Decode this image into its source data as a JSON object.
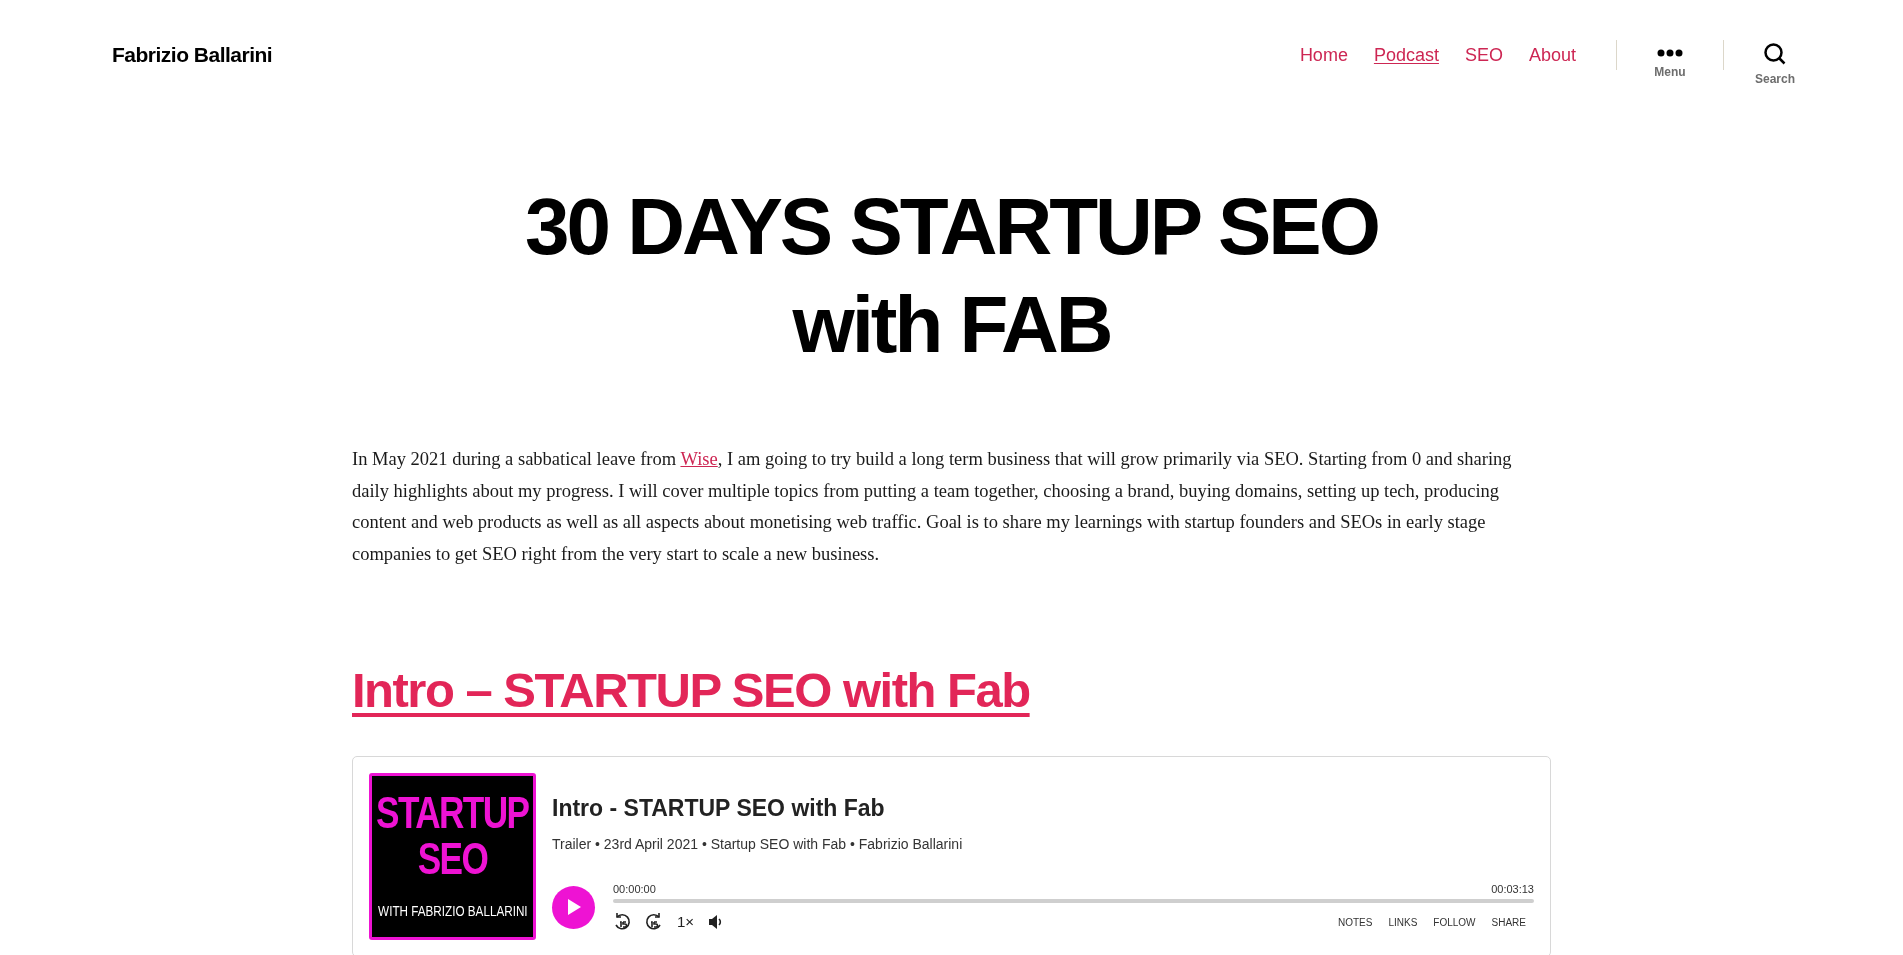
{
  "site_title": "Fabrizio Ballarini",
  "nav": [
    {
      "label": "Home",
      "selected": false
    },
    {
      "label": "Podcast",
      "selected": true
    },
    {
      "label": "SEO",
      "selected": false
    },
    {
      "label": "About",
      "selected": false
    }
  ],
  "menu_toggle": {
    "label": "Menu"
  },
  "search_toggle": {
    "label": "Search"
  },
  "page_title": "30 DAYS STARTUP SEO with FAB",
  "intro": {
    "before": "In May 2021 during a sabbatical leave from ",
    "link": "Wise",
    "after": ", I am going to try build a long term business that will grow primarily via SEO. Starting from 0 and sharing daily highlights about my progress. I will cover multiple topics from putting a team together, choosing a brand, buying domains, setting up tech, producing content and web products as well as all aspects about monetising web traffic. Goal is to share my learnings with startup founders and SEOs in early stage companies to get SEO right from the very start to scale a new business."
  },
  "episode_heading": "Intro – STARTUP SEO with Fab",
  "player": {
    "cover": {
      "title_lines": [
        "STARTUP",
        "SEO"
      ],
      "subtitle": "WITH FABRIZIO BALLARINI"
    },
    "title": "Intro - STARTUP SEO with Fab",
    "meta": "Trailer • 23rd April 2021 • Startup SEO with Fab • Fabrizio Ballarini",
    "elapsed": "00:00:00",
    "duration": "00:03:13",
    "speed": "1×",
    "actions": [
      "NOTES",
      "LINKS",
      "FOLLOW",
      "SHARE"
    ]
  }
}
